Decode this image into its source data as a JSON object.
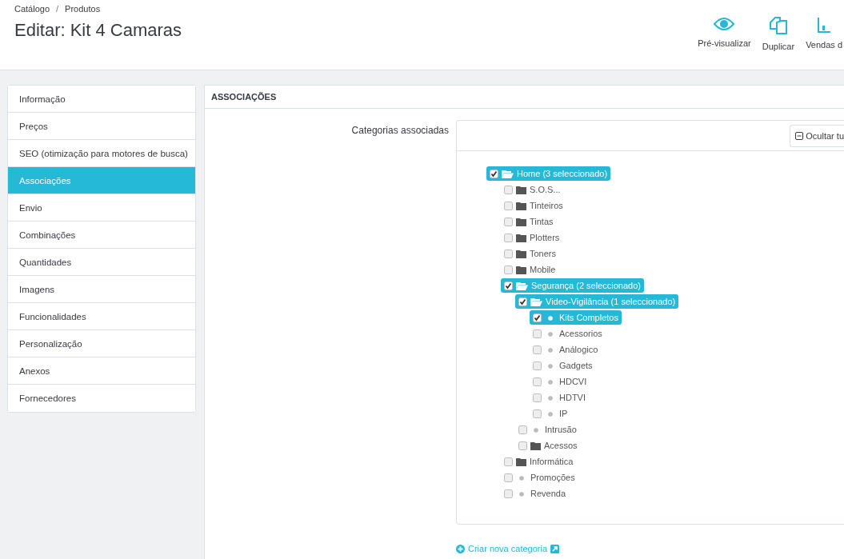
{
  "breadcrumb": {
    "items": [
      "Catálogo",
      "Produtos"
    ],
    "separator": "/"
  },
  "page_title": "Editar: Kit 4 Camaras",
  "toolbar": [
    {
      "label": "Pré-visualizar",
      "kind": "eye"
    },
    {
      "label": "Duplicar",
      "kind": "copy"
    },
    {
      "label": "Vendas d",
      "kind": "chart"
    }
  ],
  "sidebar": {
    "items": [
      {
        "label": "Informação",
        "selected": false
      },
      {
        "label": "Preços",
        "selected": false
      },
      {
        "label": "SEO (otimização para motores de busca)",
        "selected": false
      },
      {
        "label": "Associações",
        "selected": true
      },
      {
        "label": "Envio",
        "selected": false
      },
      {
        "label": "Combinações",
        "selected": false
      },
      {
        "label": "Quantidades",
        "selected": false
      },
      {
        "label": "Imagens",
        "selected": false
      },
      {
        "label": "Funcionalidades",
        "selected": false
      },
      {
        "label": "Personalização",
        "selected": false
      },
      {
        "label": "Anexos",
        "selected": false
      },
      {
        "label": "Fornecedores",
        "selected": false
      }
    ]
  },
  "panel": {
    "title": "ASSOCIAÇÕES",
    "field_label": "Categorias associadas",
    "collapse_button": "Ocultar tu",
    "create_link": "Criar nova categoria",
    "tree": [
      {
        "label": "Home (3 seleccionado)",
        "kind": "folder",
        "expanded": true,
        "checked": true,
        "children": [
          {
            "label": "S.O.S...",
            "kind": "folder",
            "expanded": false,
            "checked": false
          },
          {
            "label": "Tinteiros",
            "kind": "folder",
            "expanded": false,
            "checked": false
          },
          {
            "label": "Tintas",
            "kind": "folder",
            "expanded": false,
            "checked": false
          },
          {
            "label": "Plotters",
            "kind": "folder",
            "expanded": false,
            "checked": false
          },
          {
            "label": "Toners",
            "kind": "folder",
            "expanded": false,
            "checked": false
          },
          {
            "label": "Mobile",
            "kind": "folder",
            "expanded": false,
            "checked": false
          },
          {
            "label": "Segurança (2 seleccionado)",
            "kind": "folder",
            "expanded": true,
            "checked": true,
            "children": [
              {
                "label": "Video-Vigilância (1 seleccionado)",
                "kind": "folder",
                "expanded": true,
                "checked": true,
                "children": [
                  {
                    "label": "Kits Completos",
                    "kind": "leaf",
                    "checked": true
                  },
                  {
                    "label": "Acessorios",
                    "kind": "leaf",
                    "checked": false
                  },
                  {
                    "label": "Análogico",
                    "kind": "leaf",
                    "checked": false
                  },
                  {
                    "label": "Gadgets",
                    "kind": "leaf",
                    "checked": false
                  },
                  {
                    "label": "HDCVI",
                    "kind": "leaf",
                    "checked": false
                  },
                  {
                    "label": "HDTVI",
                    "kind": "leaf",
                    "checked": false
                  },
                  {
                    "label": "IP",
                    "kind": "leaf",
                    "checked": false
                  }
                ]
              },
              {
                "label": "Intrusão",
                "kind": "leaf",
                "checked": false
              },
              {
                "label": "Acessos",
                "kind": "folder",
                "expanded": false,
                "checked": false
              }
            ]
          },
          {
            "label": "Informática",
            "kind": "folder",
            "expanded": false,
            "checked": false
          },
          {
            "label": "Promoções",
            "kind": "leaf",
            "checked": false
          },
          {
            "label": "Revenda",
            "kind": "leaf",
            "checked": false
          }
        ]
      }
    ]
  }
}
